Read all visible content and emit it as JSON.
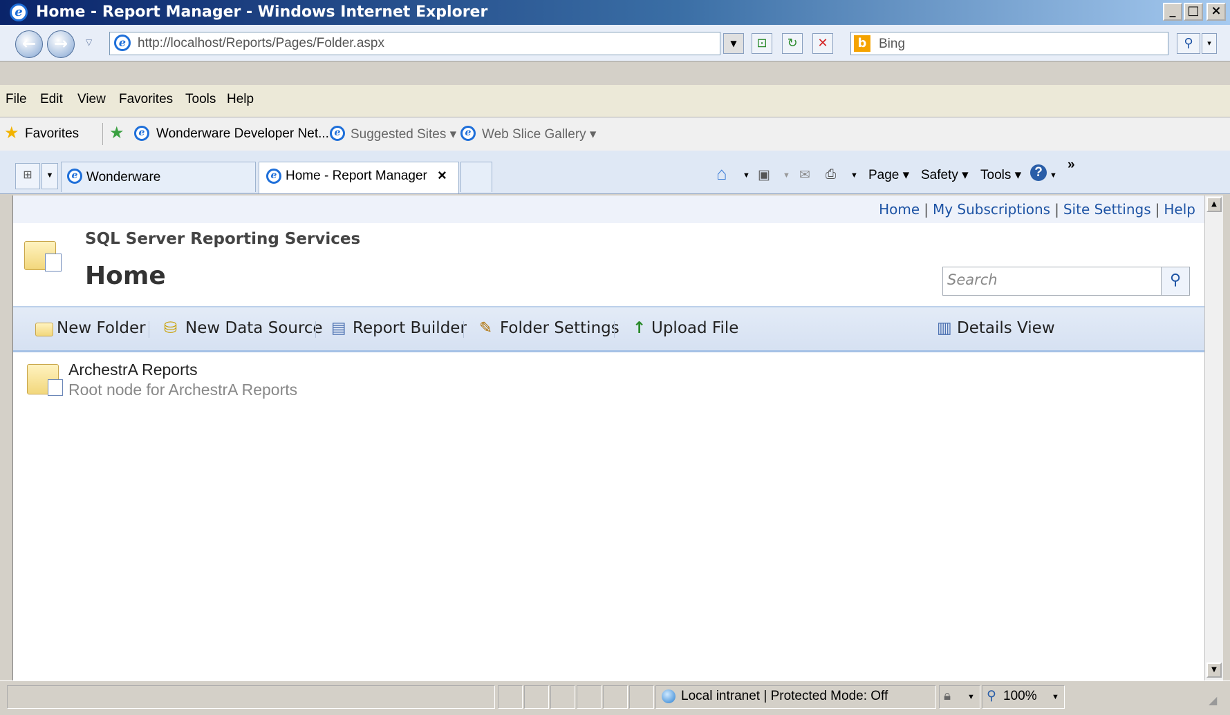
{
  "window": {
    "title": "Home - Report Manager - Windows Internet Explorer",
    "controls": [
      "_",
      "□",
      "×"
    ]
  },
  "address": {
    "url": "http://localhost/Reports/Pages/Folder.aspx",
    "search_provider": "Bing"
  },
  "menu": [
    "File",
    "Edit",
    "View",
    "Favorites",
    "Tools",
    "Help"
  ],
  "favorites": {
    "label": "Favorites",
    "items": [
      "Wonderware Developer Net...",
      "Suggested Sites ▾",
      "Web Slice Gallery ▾"
    ]
  },
  "tabs": [
    {
      "label": "Wonderware"
    },
    {
      "label": "Home - Report Manager",
      "close": "×"
    }
  ],
  "commandbar": {
    "page": "Page ▾",
    "safety": "Safety ▾",
    "tools": "Tools ▾",
    "more": "»"
  },
  "page": {
    "top_links": [
      "Home",
      "My Subscriptions",
      "Site Settings",
      "Help"
    ],
    "product": "SQL Server Reporting Services",
    "title": "Home",
    "search_placeholder": "Search",
    "toolbar": {
      "new_folder": "New Folder",
      "new_data_source": "New Data Source",
      "report_builder": "Report Builder",
      "folder_settings": "Folder Settings",
      "upload_file": "Upload File",
      "details_view": "Details View"
    },
    "items": [
      {
        "name": "ArchestrA Reports",
        "description": "Root node for ArchestrA Reports"
      }
    ]
  },
  "status": {
    "zone": "Local intranet | Protected Mode: Off",
    "zoom": "100%"
  },
  "colors": {
    "link": "#1d53a4",
    "toolbar_bg": "#dde6f4",
    "title_gradient_start": "#0a246a"
  }
}
